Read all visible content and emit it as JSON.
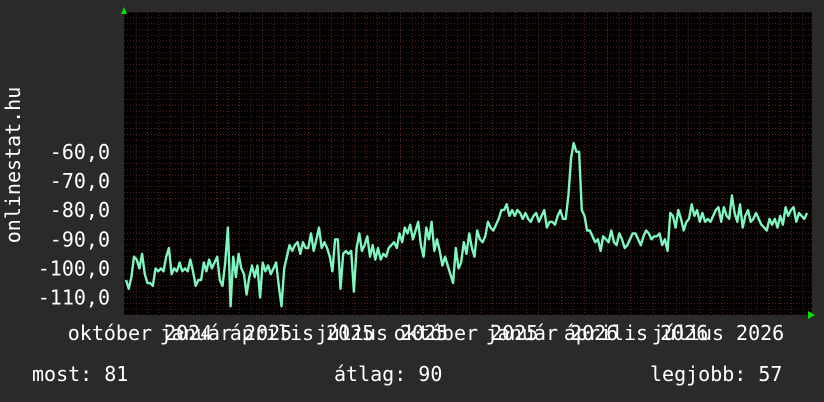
{
  "colors": {
    "background": "#2a2a2a",
    "plot_background": "#000000",
    "grid": "#5a2525",
    "line": "#7ff5bf",
    "axis_arrow": "#00e000",
    "text": "#ffffff"
  },
  "chart_data": {
    "type": "line",
    "title": "",
    "ylabel": "onlinestat.hu",
    "xlabel": "",
    "ylim": [
      -116,
      -12
    ],
    "y_ticks": [
      "-60,0",
      "-70,0",
      "-80,0",
      "-90,0",
      "-100,0",
      "-110,0"
    ],
    "y_tick_values": [
      -60,
      -70,
      -80,
      -90,
      -100,
      -110
    ],
    "x_tick_labels": [
      "október 2024",
      "január 2025",
      "április 2025",
      "július 2025",
      "október 2025",
      "január 2026",
      "április 2026",
      "július 2026"
    ],
    "grid": true,
    "series": [
      {
        "values": [
          -104,
          -107,
          -103,
          -96,
          -97,
          -100,
          -95,
          -102,
          -105,
          -105,
          -106,
          -100,
          -101,
          -100,
          -101,
          -96,
          -93,
          -102,
          -100,
          -101,
          -98,
          -101,
          -100,
          -101,
          -97,
          -101,
          -106,
          -104,
          -104,
          -98,
          -101,
          -97,
          -100,
          -98,
          -96,
          -104,
          -106,
          -98,
          -86,
          -113,
          -96,
          -103,
          -95,
          -100,
          -102,
          -109,
          -103,
          -99,
          -103,
          -99,
          -110,
          -98,
          -101,
          -99,
          -102,
          -100,
          -98,
          -106,
          -113,
          -100,
          -96,
          -92,
          -94,
          -92,
          -91,
          -95,
          -91,
          -93,
          -93,
          -88,
          -94,
          -90,
          -86,
          -93,
          -91,
          -93,
          -96,
          -101,
          -90,
          -90,
          -107,
          -95,
          -94,
          -95,
          -94,
          -108,
          -93,
          -88,
          -94,
          -92,
          -89,
          -96,
          -92,
          -97,
          -93,
          -97,
          -95,
          -96,
          -93,
          -92,
          -91,
          -93,
          -88,
          -91,
          -86,
          -88,
          -85,
          -90,
          -87,
          -84,
          -92,
          -96,
          -86,
          -90,
          -84,
          -94,
          -90,
          -94,
          -99,
          -96,
          -99,
          -102,
          -105,
          -93,
          -100,
          -98,
          -91,
          -95,
          -88,
          -93,
          -96,
          -87,
          -90,
          -91,
          -89,
          -84,
          -86,
          -87,
          -85,
          -83,
          -80,
          -80,
          -78,
          -82,
          -80,
          -82,
          -80,
          -81,
          -83,
          -81,
          -83,
          -84,
          -82,
          -81,
          -84,
          -82,
          -80,
          -86,
          -84,
          -84,
          -85,
          -82,
          -80,
          -83,
          -83,
          -75,
          -62,
          -57,
          -60,
          -60,
          -80,
          -82,
          -87,
          -87,
          -89,
          -91,
          -90,
          -94,
          -89,
          -90,
          -91,
          -87,
          -91,
          -92,
          -88,
          -90,
          -93,
          -92,
          -90,
          -88,
          -88,
          -90,
          -92,
          -89,
          -87,
          -88,
          -90,
          -89,
          -89,
          -88,
          -92,
          -90,
          -94,
          -81,
          -82,
          -86,
          -80,
          -83,
          -87,
          -84,
          -83,
          -78,
          -82,
          -80,
          -84,
          -81,
          -84,
          -83,
          -84,
          -82,
          -80,
          -79,
          -84,
          -79,
          -82,
          -83,
          -75,
          -81,
          -84,
          -78,
          -86,
          -82,
          -80,
          -84,
          -83,
          -81,
          -83,
          -85,
          -86,
          -87,
          -83,
          -85,
          -83,
          -86,
          -82,
          -85,
          -79,
          -82,
          -80,
          -79,
          -84,
          -81,
          -82,
          -83,
          -81
        ]
      }
    ]
  },
  "stats": {
    "now": "most: 81",
    "avg": "átlag: 90",
    "best": "legjobb: 57"
  }
}
